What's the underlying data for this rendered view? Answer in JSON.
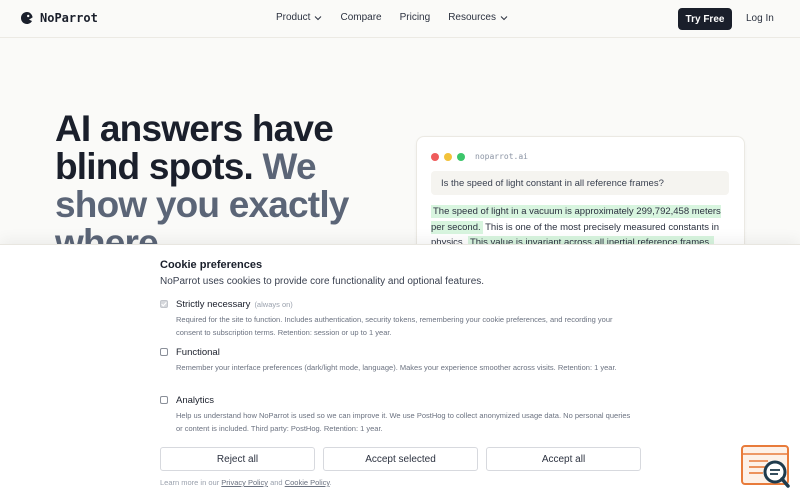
{
  "brand": {
    "name": "NoParrot",
    "icon": "parrot-logo-icon"
  },
  "nav": {
    "links": [
      {
        "label": "Product",
        "dropdown": true
      },
      {
        "label": "Compare",
        "dropdown": false
      },
      {
        "label": "Pricing",
        "dropdown": false
      },
      {
        "label": "Resources",
        "dropdown": true
      }
    ],
    "try_free": "Try Free",
    "login": "Log In"
  },
  "hero": {
    "line1": "AI answers have",
    "line2a": "blind spots.",
    "line2b": "We",
    "line3": "show you exactly",
    "line4": "where."
  },
  "demo": {
    "url": "noparrot.ai",
    "question": "Is the speed of light constant in all reference frames?",
    "answer_hl1": "The speed of light in a vacuum is approximately 299,792,458 meters per second.",
    "answer_plain": "This is one of the most precisely measured constants in physics.",
    "answer_hl2": "This value is invariant across all inertial reference frames.",
    "colors": {
      "red": "#ef5b5b",
      "yellow": "#f2c23a",
      "green": "#3cc66b",
      "highlight": "#d8f5df"
    }
  },
  "cookie": {
    "title": "Cookie preferences",
    "intro": "NoParrot uses cookies to provide core functionality and optional features.",
    "options": [
      {
        "name": "Strictly necessary",
        "tag": "(always on)",
        "checked": true,
        "disabled": true,
        "desc": "Required for the site to function. Includes authentication, security tokens, remembering your cookie preferences, and recording your consent to subscription terms. Retention: session or up to 1 year."
      },
      {
        "name": "Functional",
        "tag": "",
        "checked": false,
        "disabled": false,
        "desc": "Remember your interface preferences (dark/light mode, language). Makes your experience smoother across visits. Retention: 1 year."
      },
      {
        "name": "Analytics",
        "tag": "",
        "checked": false,
        "disabled": false,
        "desc": "Help us understand how NoParrot is used so we can improve it. We use PostHog to collect anonymized usage data. No personal queries or content is included. Third party: PostHog. Retention: 1 year."
      }
    ],
    "buttons": {
      "reject": "Reject all",
      "accept_selected": "Accept selected",
      "accept_all": "Accept all"
    },
    "footer": {
      "prefix": "Learn more in our",
      "privacy": "Privacy Policy",
      "and": "and",
      "cookie_policy": "Cookie Policy",
      "suffix": "."
    }
  },
  "widget": {
    "icon": "document-search-icon",
    "accent": "#e87b3a"
  }
}
